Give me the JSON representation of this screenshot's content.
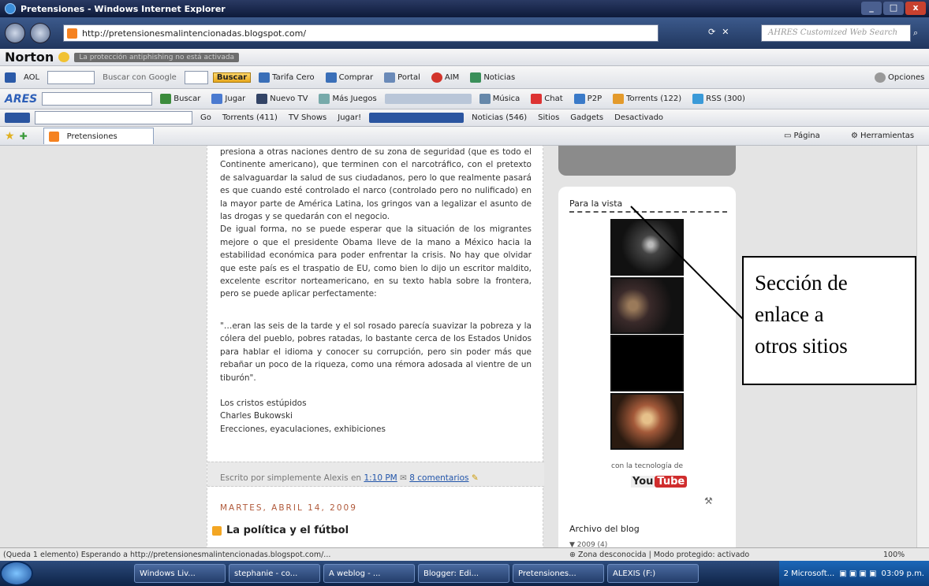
{
  "window": {
    "title": "Pretensiones - Windows Internet Explorer",
    "controls": [
      "_",
      "□",
      "x"
    ]
  },
  "address": {
    "url": "http://pretensionesmalintencionadas.blogspot.com/",
    "search_placeholder": "AHRES Customized Web Search"
  },
  "norton": {
    "brand": "Norton",
    "message": "La protección antiphishing no está activada"
  },
  "aol": {
    "aol": "AOL",
    "search_with": "Buscar con Google",
    "search_btn": "Buscar",
    "items": [
      "Tarifa Cero",
      "Comprar",
      "Portal",
      "AIM",
      "Noticias"
    ],
    "options": "Opciones"
  },
  "ares": {
    "brand": "ARES",
    "items": [
      "Buscar",
      "Jugar",
      "Nuevo TV",
      "Más Juegos",
      "Música",
      "Chat",
      "P2P",
      "Torrents (122)",
      "RSS (300)"
    ]
  },
  "tb4": {
    "items": [
      "Go",
      "Torrents (411)",
      "TV Shows",
      "Jugar!",
      "Noticias (546)",
      "Sitios",
      "Gadgets",
      "Desactivado"
    ]
  },
  "tab": {
    "label": "Pretensiones"
  },
  "cmdbar": {
    "items": [
      "Página",
      "Herramientas"
    ]
  },
  "post": {
    "paragraphs": [
      "presiona a otras naciones dentro de su zona de seguridad (que es todo el Continente americano), que terminen con el narcotráfico, con el pretexto de salvaguardar la salud de sus ciudadanos, pero lo que realmente pasará es que cuando esté controlado el narco (controlado pero no nulificado) en la mayor parte de América Latina, los gringos van a legalizar el asunto de las drogas y se quedarán con el negocio.",
      "De igual forma, no se puede esperar que la situación de los migrantes mejore o que el presidente Obama lleve de la mano a México hacia la estabilidad económica para poder enfrentar la crisis. No hay que olvidar que este país es el traspatio de EU, como bien lo dijo un escritor maldito, excelente escritor norteamericano, en su texto habla sobre la frontera, pero se puede aplicar perfectamente:"
    ],
    "quote": "\"…eran las seis de la tarde y el sol rosado parecía suavizar la pobreza y la cólera del pueblo, pobres ratadas, lo bastante cerca de los Estados Unidos para hablar el idioma y conocer su corrupción, pero sin poder más que rebañar un poco de la riqueza, como una rémora adosada al vientre de un tiburón\".",
    "sig": [
      "Los cristos estúpidos",
      "Charles Bukowski",
      "Erecciones, eyaculaciones, exhibiciones"
    ],
    "footer_prefix": "Escrito por simplemente Alexis en",
    "footer_time": "1:10 PM",
    "footer_comments": "8 comentarios",
    "next_date": "MARTES, ABRIL 14, 2009",
    "next_title": "La política y el fútbol"
  },
  "sidebar": {
    "heading": "Para la vista",
    "powered": "con la tecnología de",
    "yt_you": "You",
    "yt_tube": "Tube",
    "archive": "Archivo del blog",
    "archive_year": "▼ 2009 (4)"
  },
  "callout": {
    "lines": [
      "Sección de",
      "enlace a",
      "otros sitios"
    ]
  },
  "status": {
    "left": "(Queda 1 elemento) Esperando a http://pretensionesmalintencionadas.blogspot.com/...",
    "zone": "Zona desconocida | Modo protegido: activado",
    "zoom": "100%"
  },
  "taskbar": {
    "items": [
      "Windows Liv...",
      "stephanie  - co...",
      "A weblog - ...",
      "Blogger: Edi...",
      "Pretensiones...",
      "ALEXIS (F:)",
      "2 Microsoft..."
    ],
    "clock": "03:09 p.m."
  }
}
